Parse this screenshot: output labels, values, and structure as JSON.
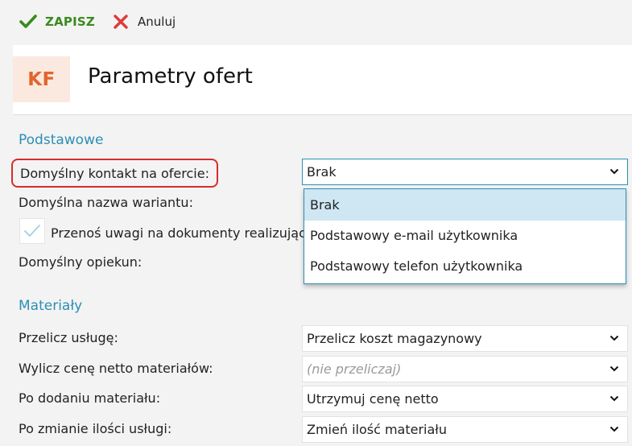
{
  "toolbar": {
    "save_label": "ZAPISZ",
    "cancel_label": "Anuluj",
    "save_color": "#3a8a1e",
    "cancel_icon_color": "#e03a3a"
  },
  "header": {
    "avatar_text": "KF",
    "title": "Parametry ofert",
    "avatar_color": "#e0672b"
  },
  "sections": {
    "basic_title": "Podstawowe",
    "materials_title": "Materiały"
  },
  "basic": {
    "default_contact_label": "Domyślny kontakt na ofercie:",
    "default_contact_value": "Brak",
    "default_variant_label": "Domyślna nazwa wariantu:",
    "transfer_notes_label": "Przenoś uwagi na dokumenty realizując",
    "default_guardian_label": "Domyślny opiekun:"
  },
  "dropdown": {
    "options": [
      "Brak",
      "Podstawowy e-mail użytkownika",
      "Podstawowy telefon użytkownika"
    ],
    "selected": "Brak"
  },
  "materials": {
    "recalc_service_label": "Przelicz usługę:",
    "recalc_service_value": "Przelicz koszt magazynowy",
    "net_price_label": "Wylicz cenę netto materiałów:",
    "net_price_placeholder": "(nie przeliczaj)",
    "after_adding_label": "Po dodaniu materiału:",
    "after_adding_value": "Utrzymuj cenę netto",
    "qty_change_label": "Po zmianie ilości usługi:",
    "qty_change_value": "Zmień ilość materiału"
  },
  "colors": {
    "accent": "#2c8fb5",
    "highlight_border": "#d62c2c",
    "selected_option_bg": "#cfe6f3"
  }
}
